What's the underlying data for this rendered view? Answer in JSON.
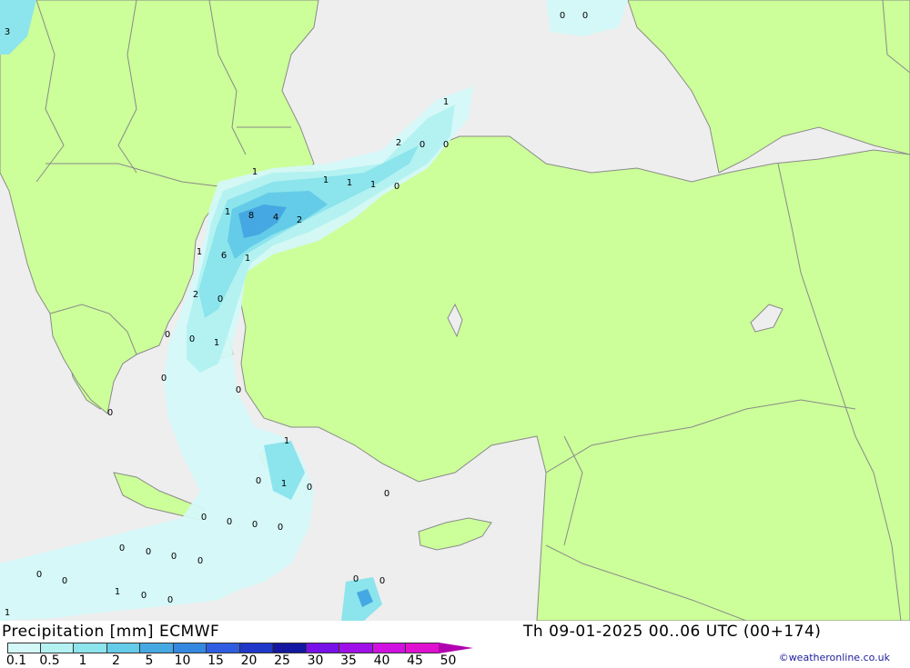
{
  "footer": {
    "title_left": "Precipitation [mm] ECMWF",
    "title_right": "Th 09-01-2025 00..06 UTC (00+174)",
    "credit": "©weatheronline.co.uk"
  },
  "legend": {
    "entries": [
      {
        "label": "0.1",
        "color": "#d4f8f8"
      },
      {
        "label": "0.5",
        "color": "#b4f2f2"
      },
      {
        "label": "1",
        "color": "#8ce4ec"
      },
      {
        "label": "2",
        "color": "#64cce8"
      },
      {
        "label": "5",
        "color": "#46a8e2"
      },
      {
        "label": "10",
        "color": "#3488e0"
      },
      {
        "label": "15",
        "color": "#2f5ce0"
      },
      {
        "label": "20",
        "color": "#2038c8"
      },
      {
        "label": "25",
        "color": "#1418a0"
      },
      {
        "label": "30",
        "color": "#7810e8"
      },
      {
        "label": "35",
        "color": "#a010e8"
      },
      {
        "label": "40",
        "color": "#d010e0"
      },
      {
        "label": "45",
        "color": "#e010d0"
      },
      {
        "label": "50",
        "color": "#b000b0"
      }
    ]
  },
  "colors": {
    "land": "#ccff99",
    "sea": "#eeeeee",
    "border": "#8a8a8a"
  },
  "map_labels": [
    {
      "text": "3",
      "lon": 0,
      "lat": 0
    },
    {
      "text": "0"
    },
    {
      "text": "0"
    },
    {
      "text": "1"
    },
    {
      "text": "2"
    },
    {
      "text": "0"
    },
    {
      "text": "0"
    },
    {
      "text": "1"
    },
    {
      "text": "1"
    },
    {
      "text": "1"
    },
    {
      "text": "1"
    },
    {
      "text": "0"
    },
    {
      "text": "1"
    },
    {
      "text": "8"
    },
    {
      "text": "4"
    },
    {
      "text": "2"
    },
    {
      "text": "1"
    },
    {
      "text": "6"
    },
    {
      "text": "1"
    },
    {
      "text": "2"
    },
    {
      "text": "0"
    },
    {
      "text": "0"
    },
    {
      "text": "0"
    },
    {
      "text": "1"
    },
    {
      "text": "0"
    },
    {
      "text": "0"
    },
    {
      "text": "0"
    },
    {
      "text": "1"
    },
    {
      "text": "0"
    },
    {
      "text": "1"
    },
    {
      "text": "0"
    },
    {
      "text": "0"
    },
    {
      "text": "0"
    },
    {
      "text": "0"
    },
    {
      "text": "0"
    },
    {
      "text": "0"
    },
    {
      "text": "0"
    },
    {
      "text": "0"
    },
    {
      "text": "0"
    },
    {
      "text": "0"
    },
    {
      "text": "0"
    },
    {
      "text": "0"
    },
    {
      "text": "1"
    },
    {
      "text": "0"
    },
    {
      "text": "0"
    },
    {
      "text": "0"
    },
    {
      "text": "0"
    },
    {
      "text": "1"
    }
  ]
}
